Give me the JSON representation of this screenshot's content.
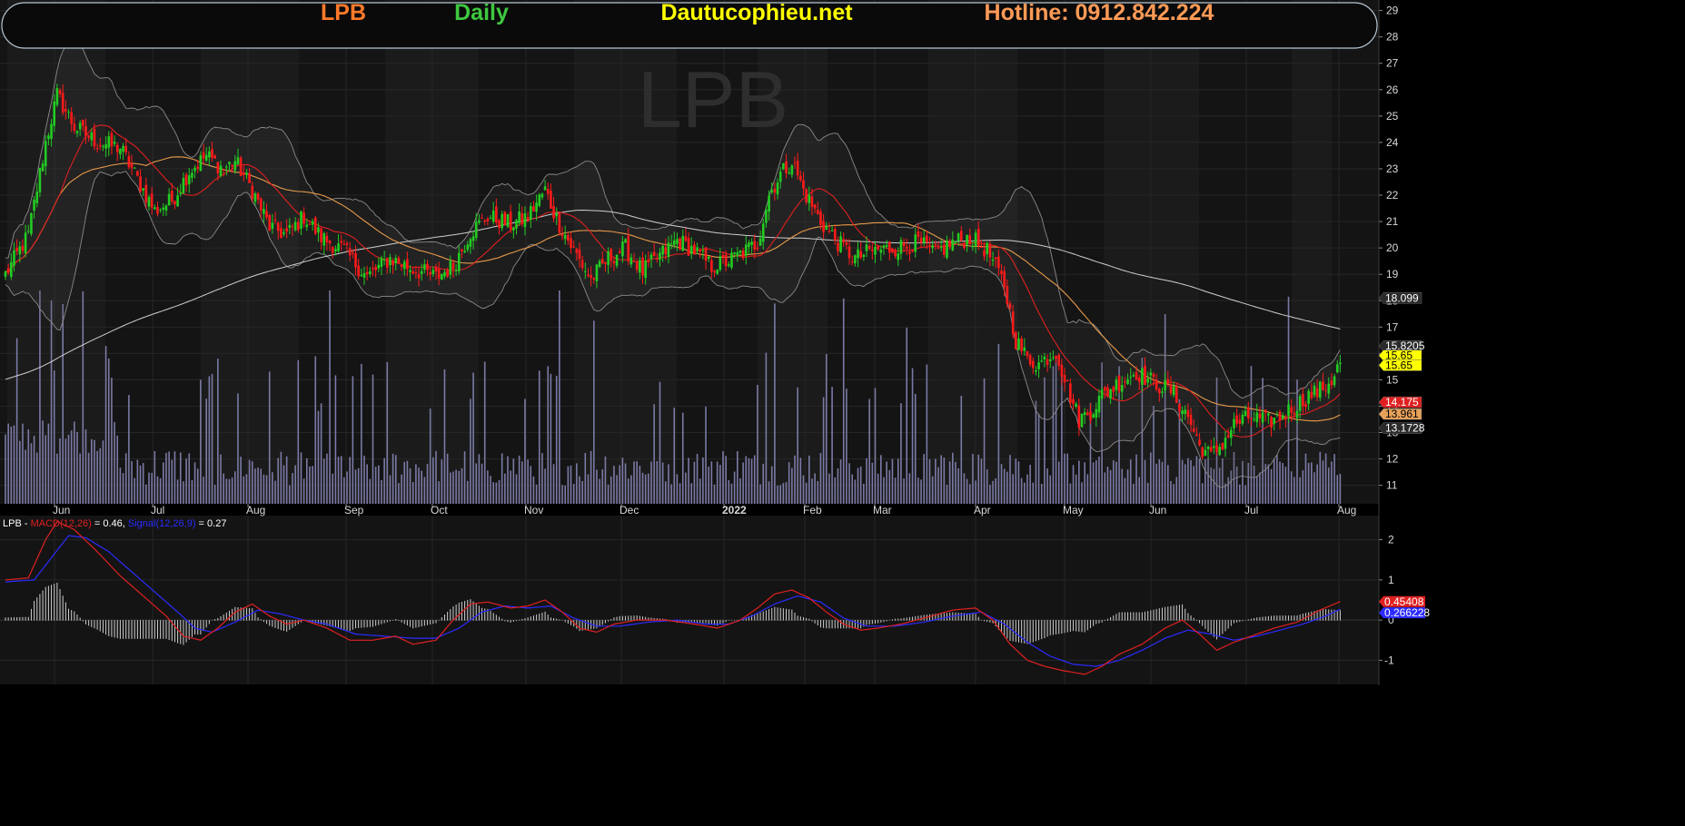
{
  "header": {
    "symbol": "LPB",
    "interval": "Daily",
    "site": "Dautucophieu.net",
    "hotline": "Hotline: 0912.842.224",
    "watermark": "LPB",
    "colors": {
      "symbol": "#ff7a2a",
      "interval": "#3ec83e",
      "site": "#ffff00",
      "hotline": "#ff9a56"
    }
  },
  "chart_data": [
    {
      "type": "candlestick",
      "title": "LPB",
      "x_ticks": [
        "Jun",
        "Jul",
        "Aug",
        "Sep",
        "Oct",
        "Nov",
        "Dec",
        "2022",
        "Feb",
        "Mar",
        "Apr",
        "May",
        "Jun",
        "Jul",
        "Aug"
      ],
      "y_ticks": [
        11,
        12,
        13,
        14,
        15,
        16,
        17,
        18,
        19,
        20,
        21,
        22,
        23,
        24,
        25,
        26,
        27,
        28,
        29
      ],
      "ylim": [
        10.3,
        29.4
      ],
      "grid": true,
      "close_anchors": [
        [
          0,
          19.0
        ],
        [
          8,
          20.5
        ],
        [
          14,
          24.0
        ],
        [
          18,
          25.8
        ],
        [
          24,
          24.6
        ],
        [
          32,
          24.0
        ],
        [
          40,
          23.8
        ],
        [
          46,
          22.6
        ],
        [
          52,
          21.4
        ],
        [
          58,
          21.8
        ],
        [
          64,
          22.9
        ],
        [
          70,
          23.5
        ],
        [
          76,
          23.0
        ],
        [
          80,
          23.3
        ],
        [
          86,
          22.2
        ],
        [
          92,
          20.8
        ],
        [
          98,
          20.5
        ],
        [
          104,
          21.2
        ],
        [
          110,
          20.4
        ],
        [
          118,
          19.9
        ],
        [
          126,
          18.9
        ],
        [
          134,
          19.6
        ],
        [
          142,
          19.2
        ],
        [
          150,
          18.9
        ],
        [
          156,
          19.3
        ],
        [
          162,
          20.6
        ],
        [
          168,
          21.2
        ],
        [
          176,
          20.9
        ],
        [
          182,
          21.2
        ],
        [
          188,
          22.2
        ],
        [
          192,
          21.1
        ],
        [
          198,
          19.9
        ],
        [
          204,
          18.8
        ],
        [
          210,
          19.6
        ],
        [
          216,
          20.0
        ],
        [
          222,
          19.1
        ],
        [
          228,
          19.7
        ],
        [
          234,
          20.3
        ],
        [
          240,
          19.9
        ],
        [
          246,
          19.3
        ],
        [
          252,
          19.5
        ],
        [
          258,
          19.9
        ],
        [
          262,
          20.2
        ],
        [
          266,
          22.0
        ],
        [
          270,
          22.8
        ],
        [
          274,
          23.3
        ],
        [
          278,
          22.2
        ],
        [
          284,
          21.0
        ],
        [
          290,
          20.2
        ],
        [
          296,
          19.6
        ],
        [
          302,
          19.9
        ],
        [
          310,
          20.0
        ],
        [
          318,
          20.2
        ],
        [
          324,
          19.8
        ],
        [
          330,
          20.2
        ],
        [
          336,
          20.4
        ],
        [
          342,
          19.9
        ],
        [
          348,
          18.6
        ],
        [
          352,
          16.5
        ],
        [
          356,
          15.8
        ],
        [
          360,
          15.6
        ],
        [
          366,
          16.1
        ],
        [
          370,
          14.7
        ],
        [
          374,
          13.5
        ],
        [
          378,
          13.8
        ],
        [
          382,
          14.4
        ],
        [
          388,
          14.9
        ],
        [
          394,
          15.3
        ],
        [
          400,
          14.9
        ],
        [
          406,
          14.6
        ],
        [
          412,
          13.6
        ],
        [
          416,
          12.5
        ],
        [
          420,
          12.1
        ],
        [
          424,
          12.6
        ],
        [
          428,
          13.3
        ],
        [
          434,
          13.6
        ],
        [
          440,
          13.4
        ],
        [
          444,
          13.6
        ],
        [
          448,
          13.9
        ],
        [
          454,
          14.4
        ],
        [
          458,
          14.6
        ],
        [
          462,
          15.0
        ],
        [
          465,
          15.65
        ]
      ],
      "overlays": [
        {
          "name": "MA20",
          "color": "#e02020"
        },
        {
          "name": "MA50",
          "color": "#e69a4a"
        },
        {
          "name": "MA200",
          "color": "#cfcfcf"
        },
        {
          "name": "Bollinger Bands",
          "color": "#8a8a8a"
        }
      ],
      "volume_color": "#7a7aa6",
      "price_tags": [
        {
          "text": "18.099",
          "value": 18.099,
          "bg": "#2a2a2a",
          "fg": "#ffffff"
        },
        {
          "text": "15.8205",
          "value": 16.28,
          "bg": "#2a2a2a",
          "fg": "#ffffff"
        },
        {
          "text": "15.65",
          "value": 15.92,
          "bg": "#ffff00",
          "fg": "#000000"
        },
        {
          "text": "15.65",
          "value": 15.55,
          "bg": "#ffff00",
          "fg": "#000000"
        },
        {
          "text": "14.175",
          "value": 14.15,
          "bg": "#e02020",
          "fg": "#ffffff"
        },
        {
          "text": "13.961",
          "value": 13.7,
          "bg": "#e6a15a",
          "fg": "#000000"
        },
        {
          "text": "13.1728",
          "value": 13.17,
          "bg": "#2a2a2a",
          "fg": "#ffffff"
        }
      ]
    },
    {
      "type": "line",
      "title": "LPB - MACD(12,26) = 0.46, Signal(12,26,9) = 0.27",
      "legend": {
        "symbol": "LPB - ",
        "macd_label": "MACD(12,26)",
        "macd_value": " = 0.46, ",
        "signal_label": "Signal(12,26,9)",
        "signal_value": " = 0.27"
      },
      "y_ticks": [
        -1,
        0,
        1,
        2
      ],
      "ylim": [
        -1.6,
        2.6
      ],
      "series": [
        {
          "name": "MACD(12,26)",
          "color": "#e02020",
          "anchors": [
            [
              0,
              1.0
            ],
            [
              8,
              1.05
            ],
            [
              14,
              2.0
            ],
            [
              18,
              2.45
            ],
            [
              24,
              2.25
            ],
            [
              32,
              1.7
            ],
            [
              40,
              1.1
            ],
            [
              48,
              0.6
            ],
            [
              56,
              0.1
            ],
            [
              62,
              -0.4
            ],
            [
              68,
              -0.5
            ],
            [
              74,
              -0.2
            ],
            [
              80,
              0.2
            ],
            [
              86,
              0.4
            ],
            [
              92,
              0.1
            ],
            [
              98,
              -0.1
            ],
            [
              104,
              0.0
            ],
            [
              112,
              -0.2
            ],
            [
              120,
              -0.5
            ],
            [
              128,
              -0.5
            ],
            [
              136,
              -0.4
            ],
            [
              142,
              -0.6
            ],
            [
              150,
              -0.5
            ],
            [
              156,
              0.0
            ],
            [
              162,
              0.4
            ],
            [
              168,
              0.45
            ],
            [
              176,
              0.3
            ],
            [
              182,
              0.35
            ],
            [
              188,
              0.5
            ],
            [
              194,
              0.2
            ],
            [
              200,
              -0.2
            ],
            [
              206,
              -0.3
            ],
            [
              212,
              -0.1
            ],
            [
              220,
              0.0
            ],
            [
              230,
              0.0
            ],
            [
              240,
              -0.1
            ],
            [
              248,
              -0.2
            ],
            [
              256,
              0.0
            ],
            [
              262,
              0.3
            ],
            [
              268,
              0.65
            ],
            [
              274,
              0.75
            ],
            [
              280,
              0.55
            ],
            [
              286,
              0.2
            ],
            [
              292,
              -0.1
            ],
            [
              298,
              -0.25
            ],
            [
              304,
              -0.2
            ],
            [
              312,
              -0.1
            ],
            [
              320,
              0.05
            ],
            [
              330,
              0.25
            ],
            [
              338,
              0.3
            ],
            [
              344,
              0.0
            ],
            [
              350,
              -0.6
            ],
            [
              356,
              -1.0
            ],
            [
              362,
              -1.15
            ],
            [
              368,
              -1.25
            ],
            [
              376,
              -1.35
            ],
            [
              382,
              -1.15
            ],
            [
              388,
              -0.85
            ],
            [
              396,
              -0.6
            ],
            [
              404,
              -0.2
            ],
            [
              410,
              0.0
            ],
            [
              416,
              -0.35
            ],
            [
              422,
              -0.75
            ],
            [
              428,
              -0.55
            ],
            [
              434,
              -0.4
            ],
            [
              442,
              -0.2
            ],
            [
              450,
              -0.05
            ],
            [
              458,
              0.25
            ],
            [
              465,
              0.46
            ]
          ]
        },
        {
          "name": "Signal(12,26,9)",
          "color": "#2b2bff",
          "anchors": [
            [
              0,
              0.95
            ],
            [
              10,
              1.0
            ],
            [
              16,
              1.55
            ],
            [
              22,
              2.1
            ],
            [
              28,
              2.05
            ],
            [
              36,
              1.7
            ],
            [
              44,
              1.2
            ],
            [
              52,
              0.7
            ],
            [
              60,
              0.2
            ],
            [
              66,
              -0.2
            ],
            [
              72,
              -0.3
            ],
            [
              80,
              -0.05
            ],
            [
              88,
              0.25
            ],
            [
              96,
              0.15
            ],
            [
              104,
              0.0
            ],
            [
              112,
              -0.1
            ],
            [
              122,
              -0.35
            ],
            [
              132,
              -0.4
            ],
            [
              142,
              -0.45
            ],
            [
              150,
              -0.45
            ],
            [
              158,
              -0.2
            ],
            [
              166,
              0.2
            ],
            [
              174,
              0.35
            ],
            [
              182,
              0.3
            ],
            [
              190,
              0.35
            ],
            [
              198,
              0.05
            ],
            [
              206,
              -0.15
            ],
            [
              214,
              -0.15
            ],
            [
              224,
              -0.05
            ],
            [
              234,
              0.0
            ],
            [
              244,
              -0.1
            ],
            [
              252,
              -0.1
            ],
            [
              260,
              0.1
            ],
            [
              268,
              0.4
            ],
            [
              276,
              0.6
            ],
            [
              284,
              0.45
            ],
            [
              292,
              0.05
            ],
            [
              300,
              -0.15
            ],
            [
              310,
              -0.15
            ],
            [
              320,
              -0.05
            ],
            [
              330,
              0.1
            ],
            [
              340,
              0.2
            ],
            [
              348,
              -0.1
            ],
            [
              356,
              -0.55
            ],
            [
              364,
              -0.9
            ],
            [
              372,
              -1.1
            ],
            [
              380,
              -1.15
            ],
            [
              388,
              -1.0
            ],
            [
              396,
              -0.75
            ],
            [
              404,
              -0.45
            ],
            [
              412,
              -0.25
            ],
            [
              420,
              -0.35
            ],
            [
              428,
              -0.5
            ],
            [
              436,
              -0.4
            ],
            [
              444,
              -0.25
            ],
            [
              452,
              -0.1
            ],
            [
              460,
              0.1
            ],
            [
              465,
              0.27
            ]
          ]
        }
      ],
      "histogram_color": "#cfcfcf",
      "value_tags": [
        {
          "text": "0.45408",
          "value": 0.46,
          "bg": "#e02020",
          "fg": "#ffffff"
        },
        {
          "text": "0.266228",
          "value": 0.18,
          "bg": "#2b2bff",
          "fg": "#ffffff"
        }
      ]
    }
  ]
}
